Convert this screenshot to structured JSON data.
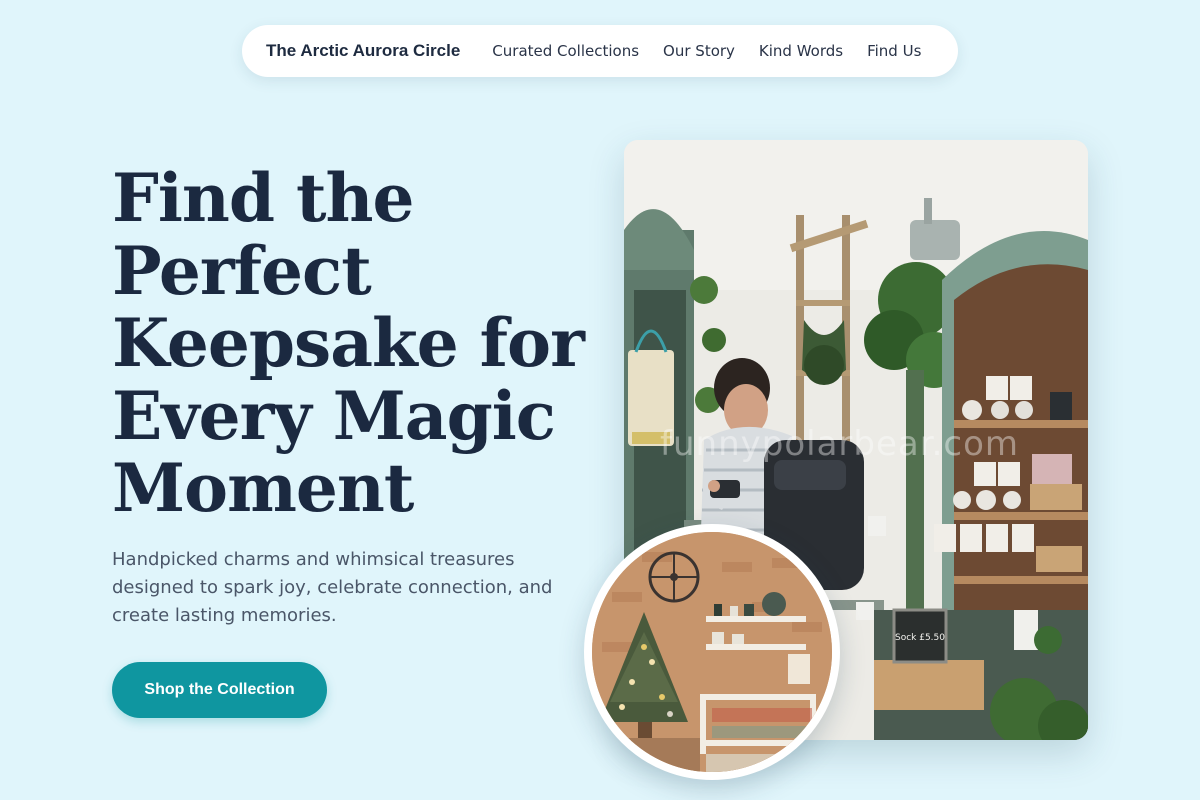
{
  "nav": {
    "brand": "The Arctic Aurora Circle",
    "links": [
      {
        "label": "Curated Collections"
      },
      {
        "label": "Our Story"
      },
      {
        "label": "Kind Words"
      },
      {
        "label": "Find Us"
      }
    ]
  },
  "hero": {
    "title_lines": [
      "Find the",
      "Perfect",
      "Keepsake for",
      "Every Magic",
      "Moment"
    ],
    "subtitle": "Handpicked charms and whimsical treasures designed to spark joy, celebrate connection, and create lasting memories.",
    "cta_label": "Shop the Collection"
  },
  "images": {
    "main_watermark": "funnypolarbear.com",
    "sign_text": "Sock £5.50"
  },
  "colors": {
    "background": "#e0f5fb",
    "accent": "#0f96a0",
    "heading": "#1b2940"
  }
}
